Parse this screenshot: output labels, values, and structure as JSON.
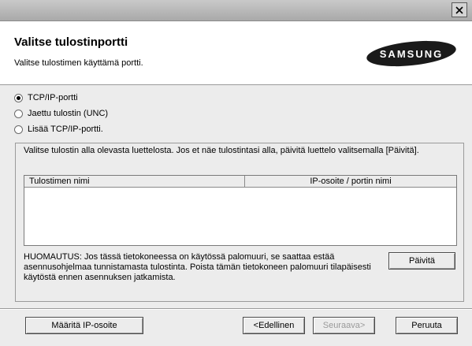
{
  "header": {
    "title": "Valitse tulostinportti",
    "subtitle": "Valitse tulostimen käyttämä portti.",
    "logo_text": "SAMSUNG"
  },
  "ports": {
    "tcpip": "TCP/IP-portti",
    "shared": "Jaettu tulostin (UNC)",
    "add_tcpip": "Lisää TCP/IP-portti.",
    "selected": "tcpip"
  },
  "main": {
    "instruction": "Valitse tulostin alla olevasta luettelosta. Jos et näe tulostintasi alla, päivitä luettelo valitsemalla [Päivitä].",
    "columns": [
      "Tulostimen nimi",
      "IP-osoite / portin nimi"
    ],
    "note": "HUOMAUTUS: Jos tässä tietokoneessa on käytössä palomuuri, se saattaa estää asennusohjelmaa tunnistamasta tulostinta. Poista tämän tietokoneen palomuuri tilapäisesti käytöstä ennen asennuksen jatkamista.",
    "refresh_label": "Päivitä"
  },
  "footer": {
    "set_ip_label": "Määritä IP-osoite",
    "back_label": "<Edellinen",
    "next_label": "Seuraava>",
    "cancel_label": "Peruuta"
  },
  "icons": {
    "close": "close-icon",
    "radio_selected": "radio-dot"
  },
  "colors": {
    "titlebar": "#b8b8b8",
    "header_bg": "#ffffff",
    "dialog_bg": "#ececec",
    "disabled_text": "#9a9a9a"
  }
}
